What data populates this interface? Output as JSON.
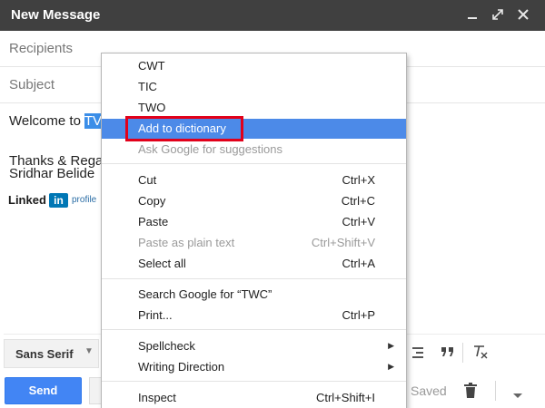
{
  "window": {
    "title": "New Message",
    "bg_color": "#404040"
  },
  "compose": {
    "recipients_placeholder": "Recipients",
    "subject_placeholder": "Subject",
    "body": {
      "line1_prefix": "Welcome to",
      "line1_selected": "TV",
      "line2": "Thanks & Rega",
      "line3": "Sridhar Belide"
    },
    "signature": {
      "brand_word": "Linked",
      "brand_box": "in",
      "profile": "profile"
    }
  },
  "toolbar": {
    "font_label": "Sans Serif",
    "font_icon": "chevron-down-icon",
    "send_label": "Send",
    "saved_label": "Saved"
  },
  "context_menu": {
    "highlight_color": "#4c8ae8",
    "outline_color": "#e2001a",
    "suggestions": [
      "CWT",
      "TIC",
      "TWO"
    ],
    "add_to_dictionary": "Add to dictionary",
    "ask_google": "Ask Google for suggestions",
    "edit_items": [
      {
        "label": "Cut",
        "shortcut": "Ctrl+X"
      },
      {
        "label": "Copy",
        "shortcut": "Ctrl+C"
      },
      {
        "label": "Paste",
        "shortcut": "Ctrl+V"
      },
      {
        "label": "Paste as plain text",
        "shortcut": "Ctrl+Shift+V"
      },
      {
        "label": "Select all",
        "shortcut": "Ctrl+A"
      }
    ],
    "search_google": "Search Google for “TWC”",
    "print": {
      "label": "Print...",
      "shortcut": "Ctrl+P"
    },
    "spellcheck": "Spellcheck",
    "writing_direction": "Writing Direction",
    "inspect": {
      "label": "Inspect",
      "shortcut": "Ctrl+Shift+I"
    }
  }
}
